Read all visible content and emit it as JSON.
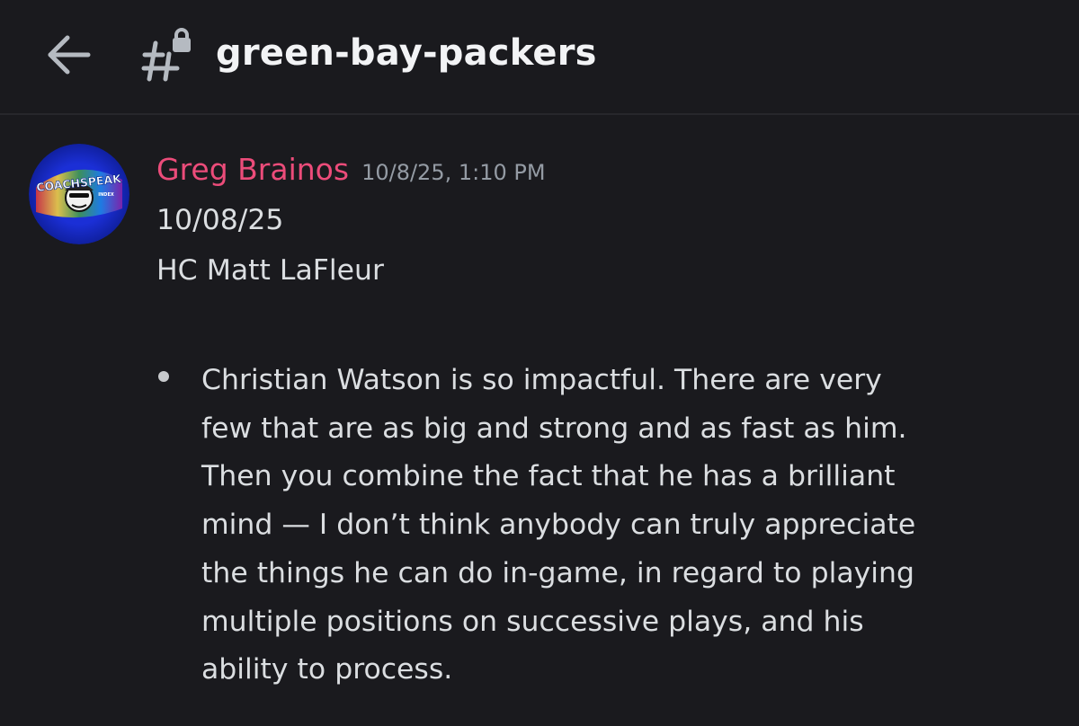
{
  "header": {
    "channel_name": "green-bay-packers",
    "back_icon": "arrow-left-icon",
    "channel_icon": "locked-hashtag-icon"
  },
  "message": {
    "author": "Greg Brainos",
    "timestamp": "10/8/25, 1:10 PM",
    "avatar": {
      "text_line1": "COACHSPEAK",
      "text_line2": "INDEX"
    },
    "lines": [
      "10/08/25",
      "HC Matt LaFleur"
    ],
    "bullet_lines": [
      "Christian Watson is so impactful. There are very",
      "few that are as big and strong and as fast as him.",
      "Then you combine the fact that he has a brilliant",
      "mind  — I don’t think anybody can truly appreciate",
      "the things he can do in-game, in regard to playing",
      "multiple positions on successive plays, and his",
      "ability to process."
    ]
  },
  "colors": {
    "background": "#1a1a1e",
    "author": "#ec4c7a",
    "text": "#dbdee1",
    "muted": "#949ba4"
  }
}
